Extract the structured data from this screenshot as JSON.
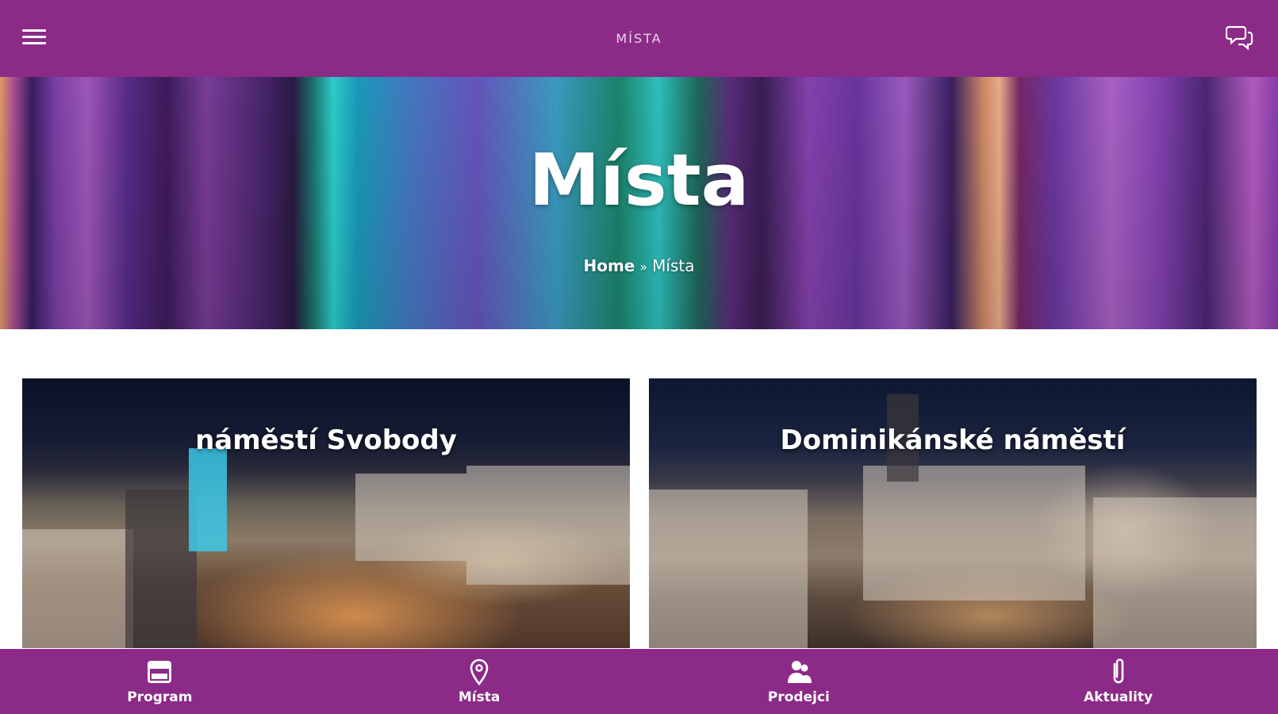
{
  "topbar": {
    "title": "MÍSTA",
    "menu_icon": "hamburger-menu-icon",
    "chat_icon": "chat-bubbles-icon"
  },
  "hero": {
    "title": "Místa",
    "breadcrumb": {
      "home": "Home",
      "separator": "»",
      "current": "Místa"
    }
  },
  "places": [
    {
      "name": "náměstí Svobody"
    },
    {
      "name": "Dominikánské náměstí"
    }
  ],
  "bottom_nav": [
    {
      "label": "Program",
      "icon": "calendar-icon"
    },
    {
      "label": "Místa",
      "icon": "map-pin-icon"
    },
    {
      "label": "Prodejci",
      "icon": "people-icon"
    },
    {
      "label": "Aktuality",
      "icon": "paperclip-icon"
    }
  ],
  "colors": {
    "brand_purple": "#8c2a88",
    "text_white": "#ffffff"
  }
}
